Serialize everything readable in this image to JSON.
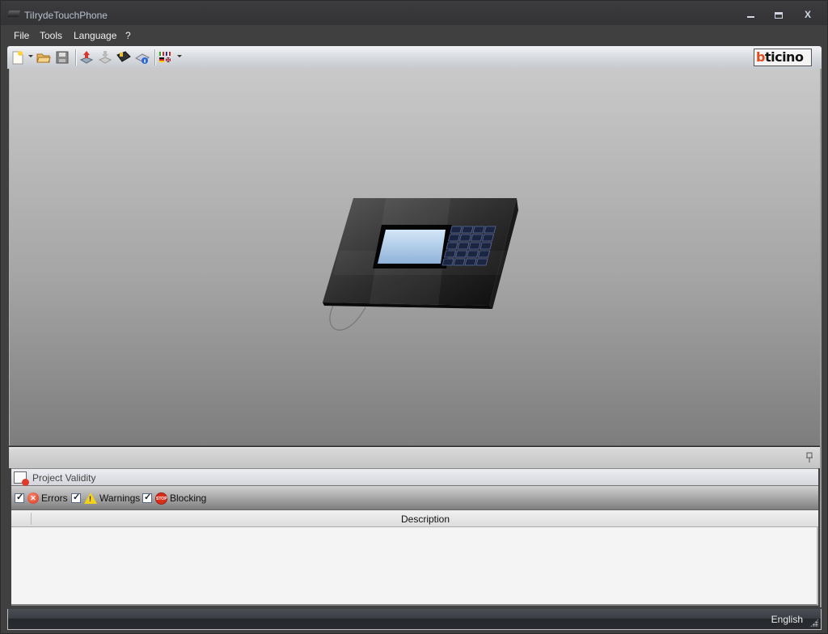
{
  "window": {
    "title": "TiIrydeTouchPhone",
    "controls": {
      "minimize": "minimize",
      "maximize": "maximize",
      "close": "X"
    }
  },
  "menu": {
    "items": [
      {
        "label": "File"
      },
      {
        "label": "Tools"
      },
      {
        "label": "Language"
      },
      {
        "label": "?"
      }
    ]
  },
  "toolbar": {
    "buttons": [
      {
        "icon": "new-document-icon",
        "has_dropdown": true
      },
      {
        "icon": "open-folder-icon"
      },
      {
        "icon": "save-icon"
      },
      {
        "icon": "upload-to-device-icon"
      },
      {
        "icon": "download-from-device-icon"
      },
      {
        "icon": "device-firmware-icon"
      },
      {
        "icon": "device-info-icon"
      },
      {
        "icon": "language-flags-icon",
        "has_dropdown": true
      }
    ],
    "logo": {
      "first": "b",
      "rest": "ticino",
      "accent_color": "#e44a1c"
    }
  },
  "canvas": {
    "device_image": "touch-phone-device"
  },
  "validity_panel": {
    "pin": "pin-icon",
    "title": "Project Validity",
    "filters": [
      {
        "label": "Errors",
        "checked": true,
        "icon": "error-icon"
      },
      {
        "label": "Warnings",
        "checked": true,
        "icon": "warning-icon"
      },
      {
        "label": "Blocking",
        "checked": true,
        "icon": "stop-icon",
        "icon_text": "STOP"
      }
    ],
    "table": {
      "columns": [
        "",
        "Description"
      ],
      "rows": []
    }
  },
  "status": {
    "language": "English"
  }
}
